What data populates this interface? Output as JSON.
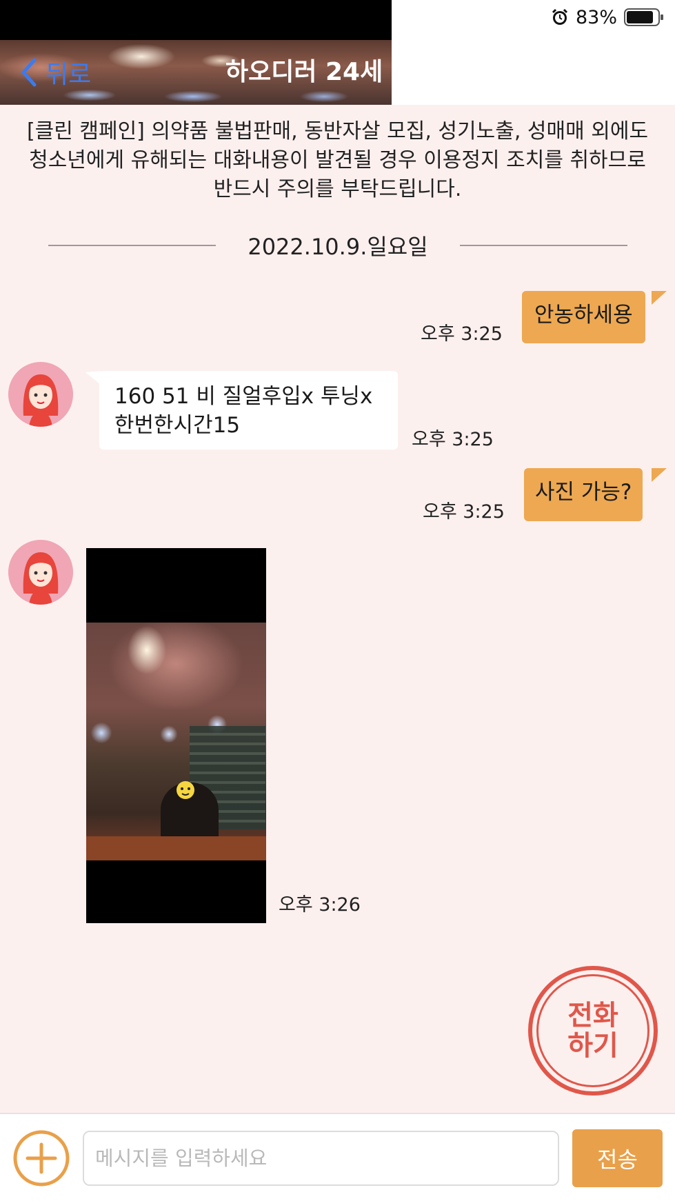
{
  "status_bar": {
    "battery_text": "83%",
    "alarm_icon": "alarm-clock-icon",
    "battery_icon": "battery-icon"
  },
  "header": {
    "back_label": "뒤로",
    "title": "하오디러 24세"
  },
  "notice": {
    "text": "[클린 캠페인] 의약품 불법판매, 동반자살 모집, 성기노출, 성매매 외에도 청소년에게 유해되는 대화내용이 발견될 경우 이용정지 조치를 취하므로 반드시 주의를 부탁드립니다."
  },
  "date_divider": "2022.10.9.일요일",
  "messages": [
    {
      "sender": "me",
      "text": "안농하세용",
      "time": "오후 3:25"
    },
    {
      "sender": "other",
      "text_lines": [
        "160 51 비 질얼후입x 투닝x",
        "한번한시간15"
      ],
      "time": "오후 3:25"
    },
    {
      "sender": "me",
      "text": "사진 가능?",
      "time": "오후 3:25"
    },
    {
      "sender": "other",
      "type": "photo",
      "time": "오후 3:26"
    }
  ],
  "call_button": {
    "label": "전화하기"
  },
  "input_bar": {
    "placeholder": "메시지를 입력하세요",
    "send_label": "전송",
    "add_icon": "plus-circle-icon"
  },
  "colors": {
    "accent": "#eda851",
    "back_link": "#3b7bf0",
    "call_red": "#e0574a",
    "background": "#fcf0ef"
  }
}
